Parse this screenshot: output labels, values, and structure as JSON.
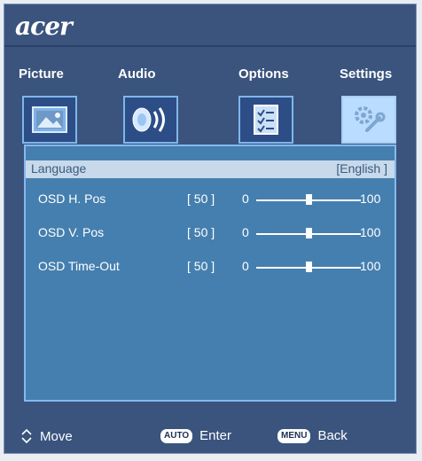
{
  "brand": "acer",
  "tabs": [
    {
      "label": "Picture",
      "icon": "picture-icon"
    },
    {
      "label": "Audio",
      "icon": "speaker-icon"
    },
    {
      "label": "Options",
      "icon": "options-list-icon"
    },
    {
      "label": "Settings",
      "icon": "wrench-gear-icon",
      "selected": true
    }
  ],
  "language": {
    "label": "Language",
    "value": "[English ]"
  },
  "rows": [
    {
      "label": "OSD H. Pos",
      "value": "[ 50 ]",
      "min": "0",
      "max": "100",
      "level": 0.5
    },
    {
      "label": "OSD V. Pos",
      "value": "[ 50 ]",
      "min": "0",
      "max": "100",
      "level": 0.5
    },
    {
      "label": "OSD Time-Out",
      "value": "[ 50 ]",
      "min": "0",
      "max": "100",
      "level": 0.5
    }
  ],
  "footer": {
    "move_label": "Move",
    "auto_badge": "AUTO",
    "enter_label": "Enter",
    "menu_badge": "MENU",
    "back_label": "Back"
  },
  "colors": {
    "frame_bg": "#3a547e",
    "content_bg": "#457faf",
    "highlight_bg": "#c7d9ea",
    "border": "#84b9ee"
  }
}
